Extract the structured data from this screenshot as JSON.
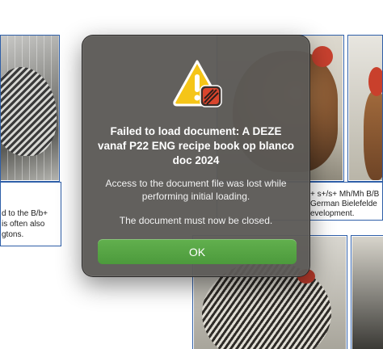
{
  "dialog": {
    "icon": "warning-triangle-icon",
    "badge_icon": "app-badge-icon",
    "title": "Failed to load document: A DEZE vanaf P22 ENG recipe book op blanco doc 2024",
    "message": "Access to the document file was lost while performing initial loading.",
    "message2": "The document must now be closed.",
    "ok_label": "OK"
  },
  "background": {
    "left_text": [
      "d to the B/b+",
      "is often also",
      "gtons."
    ],
    "right_text": [
      "+ s+/s+ Mh/Mh B/B",
      "German Bielefelde",
      "evelopment."
    ]
  },
  "colors": {
    "dialog_bg": "#5c5956",
    "ok_button": "#55a443",
    "warning_yellow": "#f5c518",
    "badge_red": "#d9452d"
  }
}
